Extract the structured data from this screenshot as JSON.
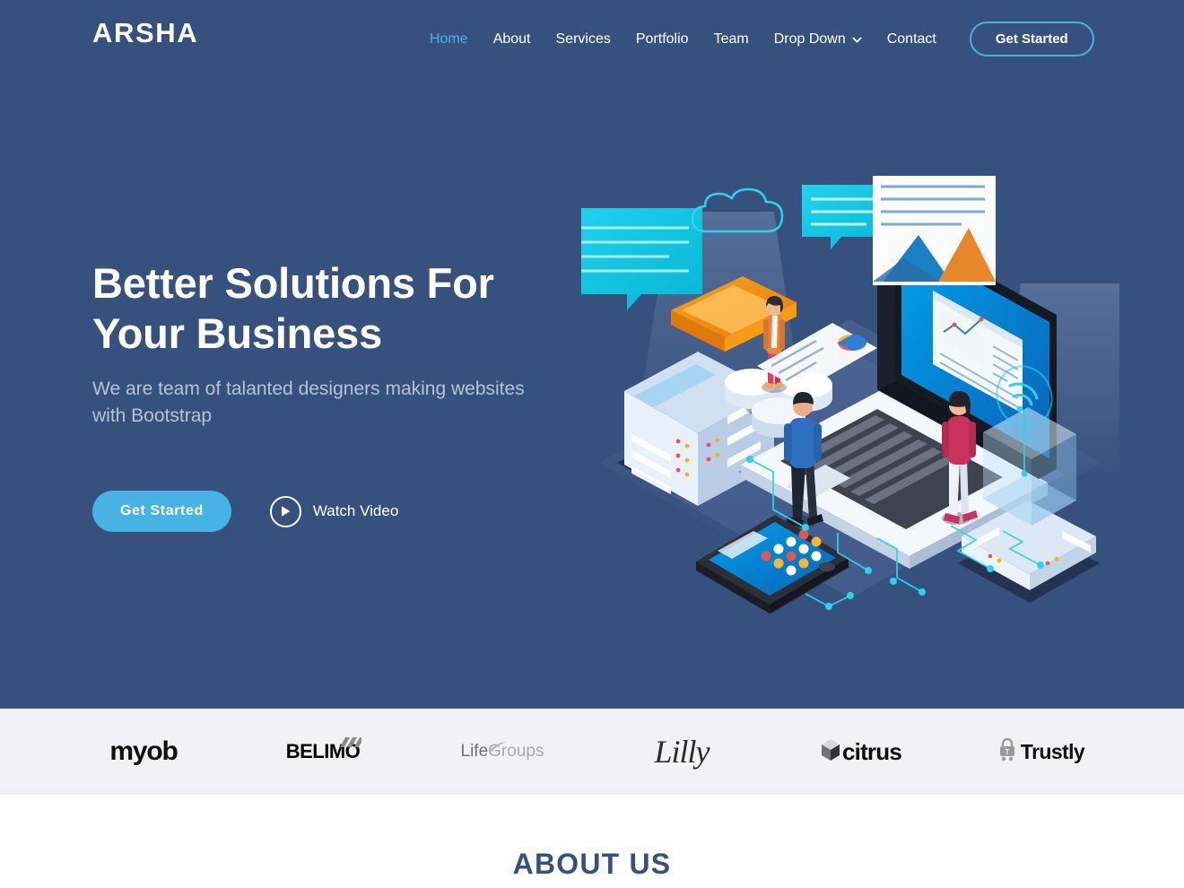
{
  "header": {
    "logo": "ARSHA",
    "nav": [
      {
        "label": "Home",
        "active": true
      },
      {
        "label": "About",
        "active": false
      },
      {
        "label": "Services",
        "active": false
      },
      {
        "label": "Portfolio",
        "active": false
      },
      {
        "label": "Team",
        "active": false
      },
      {
        "label": "Drop Down",
        "active": false,
        "icon": "chevron-down-icon"
      },
      {
        "label": "Contact",
        "active": false
      }
    ],
    "cta_label": "Get Started"
  },
  "hero": {
    "title_line1": "Better Solutions For",
    "title_line2": "Your Business",
    "subtitle": "We are team of talanted designers making websites with Bootstrap",
    "primary_cta": "Get Started",
    "video_cta": "Watch Video",
    "video_icon": "play-icon",
    "illustration": "isometric-business-technology-illustration"
  },
  "clients": [
    {
      "name": "myob",
      "icon": "myob-logo"
    },
    {
      "name": "BELIMO",
      "icon": "belimo-logo"
    },
    {
      "name_part1": "Life",
      "name_part2": "Groups",
      "icon": "lifegroups-logo"
    },
    {
      "name": "Lilly",
      "icon": "lilly-logo"
    },
    {
      "name": "citrus",
      "icon": "citrus-logo"
    },
    {
      "name": "Trustly",
      "icon": "trustly-logo"
    }
  ],
  "about": {
    "title": "ABOUT US"
  },
  "colors": {
    "hero_bg": "#37517e",
    "accent": "#47b2e4",
    "clients_bg": "#f1f2f8",
    "hero_sub_text": "#b8c2d6",
    "about_title": "#37517e"
  }
}
